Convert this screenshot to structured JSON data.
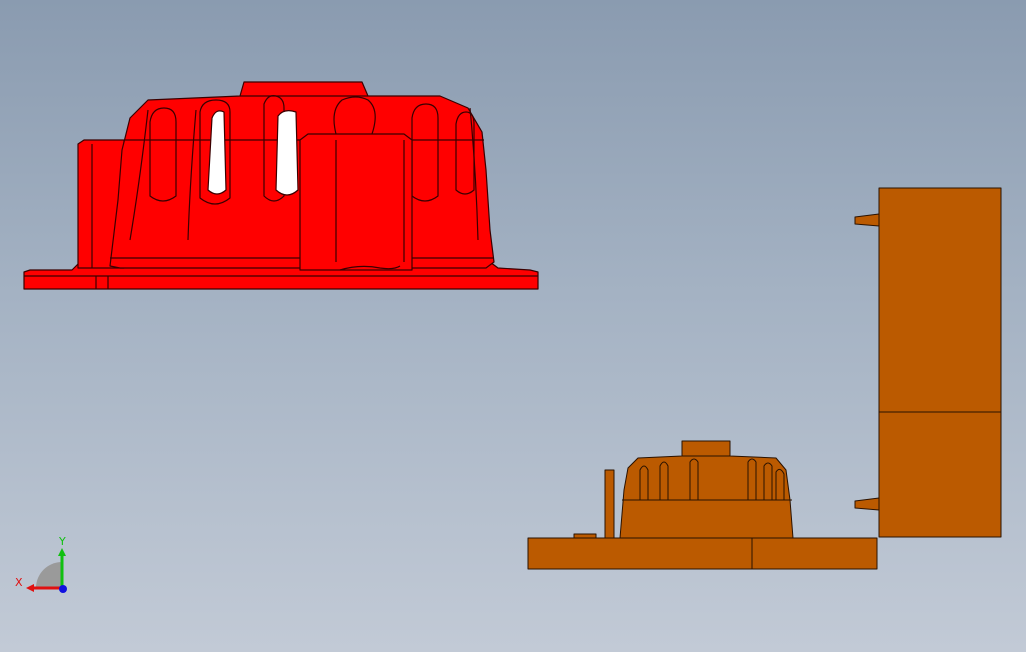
{
  "viewport": {
    "background_top": "#8a9bb0",
    "background_bottom": "#c2cad6"
  },
  "parts": {
    "selected_part": {
      "name": "cover-part-selected",
      "fill": "#ff0000",
      "edge": "#3a0000"
    },
    "mold_assembly": {
      "name": "mold-assembly",
      "fill": "#bb5a00",
      "edge": "#2a1200"
    }
  },
  "triad": {
    "x_label": "X",
    "y_label": "Y",
    "x_color": "#e01010",
    "y_color": "#10c010",
    "z_color": "#1010e0"
  }
}
